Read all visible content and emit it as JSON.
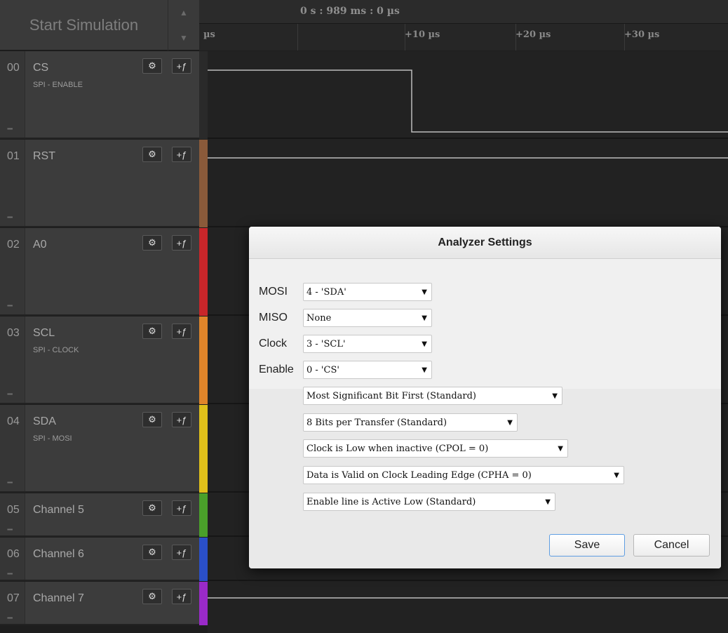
{
  "toolbar": {
    "start_label": "Start Simulation",
    "time_readout": "0 s : 989 ms : 0 µs",
    "ticks": [
      "µs",
      "+10 µs",
      "+20 µs",
      "+30 µs"
    ]
  },
  "channels": [
    {
      "num": "00",
      "name": "CS",
      "sub": "SPI - ENABLE",
      "color": "#2a2a2a"
    },
    {
      "num": "01",
      "name": "RST",
      "sub": "",
      "color": "#8a5a3a"
    },
    {
      "num": "02",
      "name": "A0",
      "sub": "",
      "color": "#c8262a"
    },
    {
      "num": "03",
      "name": "SCL",
      "sub": "SPI - CLOCK",
      "color": "#e0852a"
    },
    {
      "num": "04",
      "name": "SDA",
      "sub": "SPI - MOSI",
      "color": "#e0c01a"
    },
    {
      "num": "05",
      "name": "Channel 5",
      "sub": "",
      "color": "#4aa02a"
    },
    {
      "num": "06",
      "name": "Channel 6",
      "sub": "",
      "color": "#2a4fc8"
    },
    {
      "num": "07",
      "name": "Channel 7",
      "sub": "",
      "color": "#9a2ac8"
    }
  ],
  "icons": {
    "settings": "gear-icon",
    "trigger": "trigger-edge-icon",
    "grip": "drag-grip-icon"
  },
  "dialog": {
    "title": "Analyzer Settings",
    "mosi_label": "MOSI",
    "mosi_value": "4 - 'SDA'",
    "miso_label": "MISO",
    "miso_value": "None",
    "clock_label": "Clock",
    "clock_value": "3 - 'SCL'",
    "enable_label": "Enable",
    "enable_value": "0 - 'CS'",
    "bit_order": "Most Significant Bit First (Standard)",
    "bits_per_transfer": "8 Bits per Transfer (Standard)",
    "cpol": "Clock is Low when inactive (CPOL = 0)",
    "cpha": "Data is Valid on Clock Leading Edge (CPHA = 0)",
    "enable_polarity": "Enable line is Active Low (Standard)",
    "save_label": "Save",
    "cancel_label": "Cancel"
  }
}
